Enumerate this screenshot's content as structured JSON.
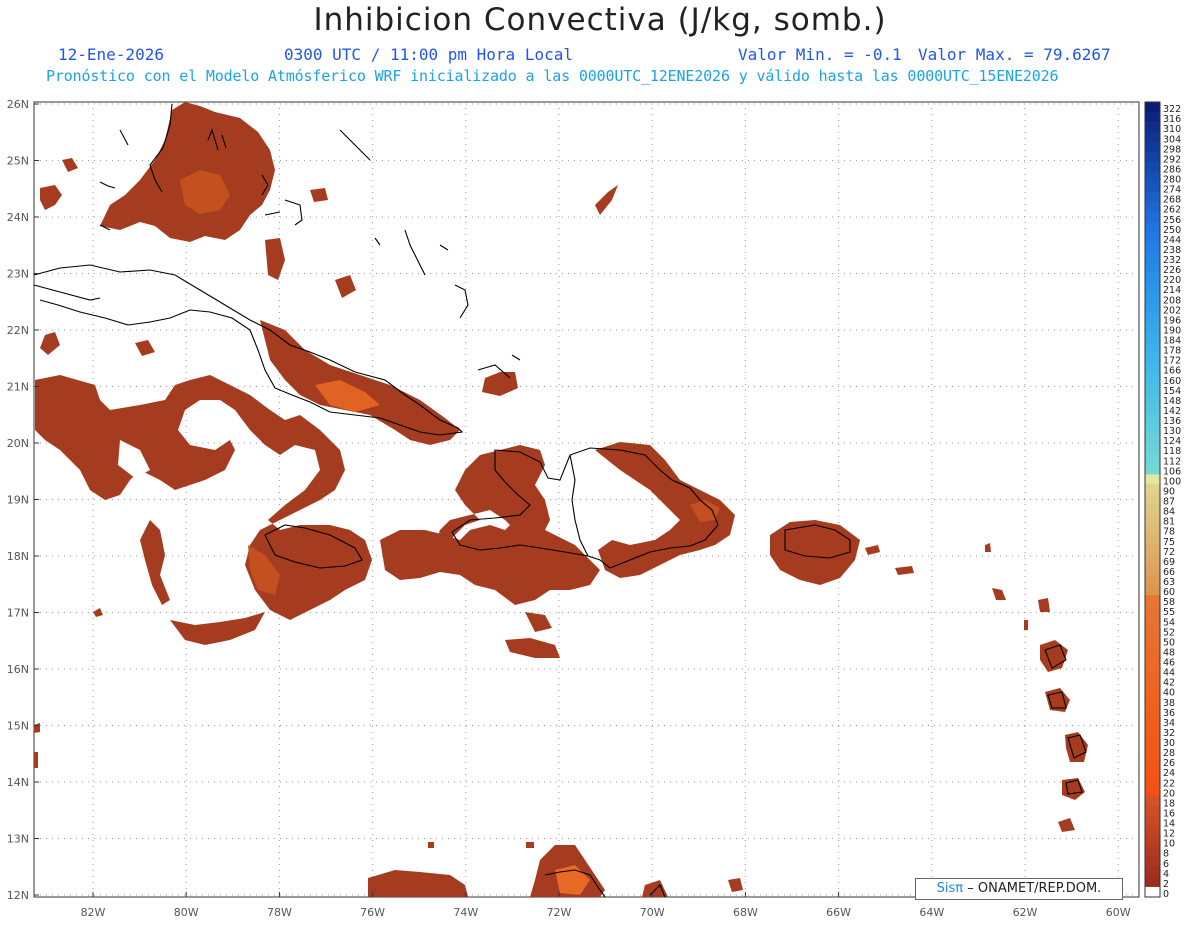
{
  "header": {
    "title": "Inhibicion Convectiva (J/kg, somb.)",
    "date": "12-Ene-2026",
    "time": "0300 UTC / 11:00 pm Hora Local",
    "min_value": "Valor Min. = -0.1",
    "max_value": "Valor Max. = 79.6267",
    "model_info": "Pronóstico con el Modelo Atmósferico WRF inicializado a las 0000UTC_12ENE2026 y válido hasta las  0000UTC_15ENE2026"
  },
  "map": {
    "lat_labels": [
      "26N",
      "25N",
      "24N",
      "23N",
      "22N",
      "21N",
      "20N",
      "19N",
      "18N",
      "17N",
      "16N",
      "15N",
      "14N",
      "13N",
      "12N"
    ],
    "lon_labels": [
      "82W",
      "80W",
      "78W",
      "76W",
      "74W",
      "72W",
      "70W",
      "68W",
      "66W",
      "64W",
      "62W",
      "60W"
    ],
    "colors": {
      "field": "#a03a1e",
      "field_hot": "#e86a25",
      "coast": "#000000",
      "grid": "#9a9a9a"
    }
  },
  "colorbar": {
    "labels": [
      "322",
      "316",
      "310",
      "304",
      "298",
      "292",
      "286",
      "280",
      "274",
      "268",
      "262",
      "256",
      "250",
      "244",
      "238",
      "232",
      "226",
      "220",
      "214",
      "208",
      "202",
      "196",
      "190",
      "184",
      "178",
      "172",
      "166",
      "160",
      "154",
      "148",
      "142",
      "136",
      "130",
      "124",
      "118",
      "112",
      "106",
      "100",
      "90",
      "87",
      "84",
      "81",
      "78",
      "75",
      "72",
      "69",
      "66",
      "63",
      "60",
      "58",
      "55",
      "54",
      "52",
      "50",
      "48",
      "46",
      "44",
      "42",
      "40",
      "38",
      "36",
      "34",
      "32",
      "30",
      "28",
      "26",
      "24",
      "22",
      "20",
      "18",
      "16",
      "14",
      "12",
      "10",
      "8",
      "6",
      "4",
      "2",
      "0"
    ]
  },
  "credit": {
    "logo": "Sisπ",
    "text": "– ONAMET/REP.DOM."
  }
}
